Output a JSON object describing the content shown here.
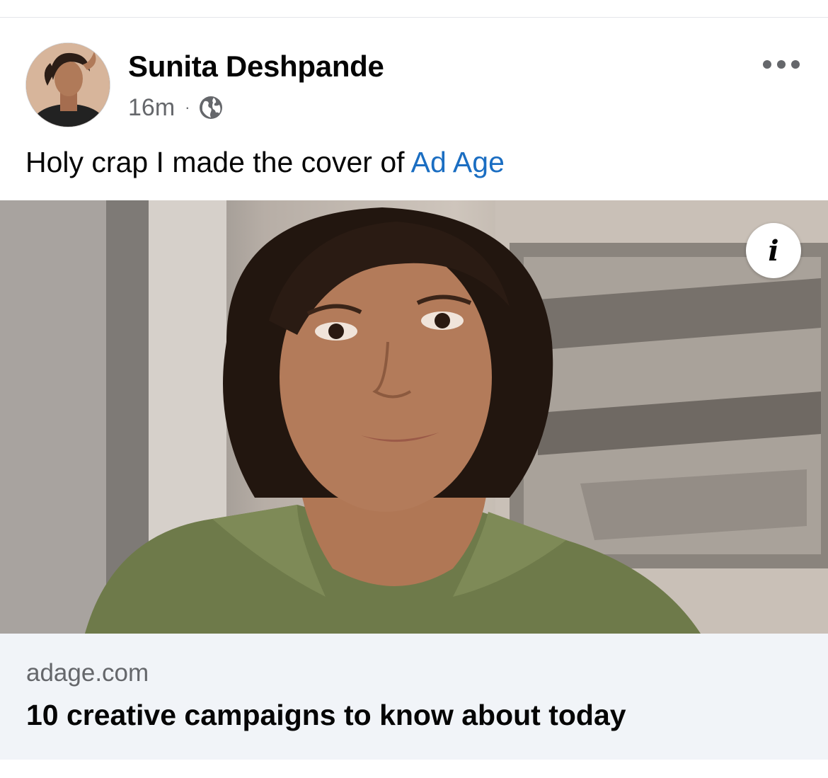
{
  "post": {
    "author": "Sunita Deshpande",
    "time": "16m",
    "separator": "·",
    "audience_icon": "globe-icon",
    "more_icon": "more-options-icon",
    "text_prefix": "Holy crap I made the cover of ",
    "text_link": "Ad Age"
  },
  "media": {
    "info_icon": "info-icon",
    "info_glyph": "i"
  },
  "link_preview": {
    "domain": "adage.com",
    "title": "10 creative campaigns to know about today"
  },
  "colors": {
    "link": "#1b6ec2",
    "text": "#050505",
    "secondary_text": "#65676b",
    "preview_background": "#f1f4f8"
  }
}
